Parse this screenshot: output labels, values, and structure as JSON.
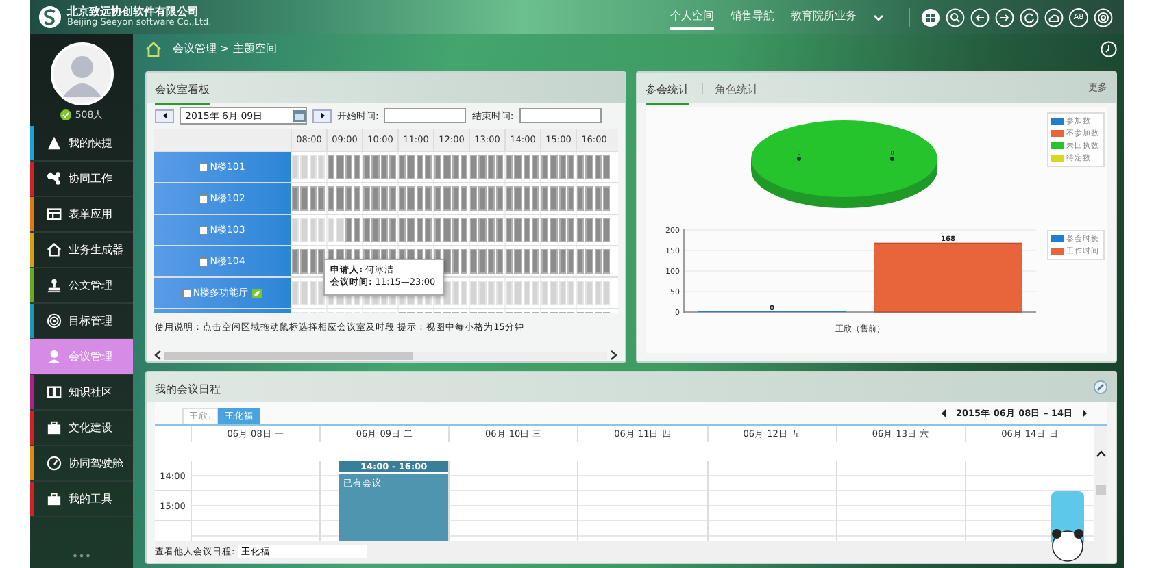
{
  "header": {
    "company": "北京致远协创软件有限公司",
    "company_en": "Beijing Seeyon software Co.,Ltd.",
    "nav": [
      {
        "label": "个人空间",
        "selected": true
      },
      {
        "label": "销售导航",
        "selected": false
      },
      {
        "label": "教育院所业务",
        "selected": false
      }
    ],
    "badge": "A8"
  },
  "sidebar": {
    "status": "508人",
    "items": [
      {
        "label": "我的快捷",
        "color": "#1aa3d6",
        "selected": false
      },
      {
        "label": "协同工作",
        "color": "#d42020",
        "selected": false
      },
      {
        "label": "表单应用",
        "color": "#e07a10",
        "selected": false
      },
      {
        "label": "业务生成器",
        "color": "#d4a010",
        "selected": false
      },
      {
        "label": "公文管理",
        "color": "#6aaa20",
        "selected": false
      },
      {
        "label": "目标管理",
        "color": "#1a9ab0",
        "selected": false
      },
      {
        "label": "会议管理",
        "color": "#d68be6",
        "selected": true
      },
      {
        "label": "知识社区",
        "color": "#b0208a",
        "selected": false
      },
      {
        "label": "文化建设",
        "color": "#d42020",
        "selected": false
      },
      {
        "label": "协同驾驶舱",
        "color": "#e08a10",
        "selected": false
      },
      {
        "label": "我的工具",
        "color": "#d42020",
        "selected": false
      }
    ],
    "more": "•••"
  },
  "breadcrumb": "会议管理 > 主题空间",
  "board": {
    "title": "会议室看板",
    "date": "2015年 6月 09日",
    "start_label": "开始时间:",
    "end_label": "结束时间:",
    "times": [
      "08:00",
      "09:00",
      "10:00",
      "11:00",
      "12:00",
      "13:00",
      "14:00",
      "15:00",
      "16:00"
    ],
    "rooms": [
      {
        "name": "N楼101",
        "checked": false,
        "has_icon": false,
        "booked": [
          false,
          false,
          false,
          false,
          true,
          true,
          true,
          true,
          true,
          true,
          true,
          true,
          true,
          true,
          true,
          true,
          true,
          true,
          true,
          true,
          true,
          true,
          true,
          true,
          true,
          true,
          true,
          true,
          true,
          true,
          true,
          true,
          true,
          true,
          true,
          true
        ]
      },
      {
        "name": "N楼102",
        "checked": false,
        "has_icon": false,
        "booked": [
          true,
          true,
          true,
          true,
          true,
          true,
          true,
          true,
          true,
          true,
          true,
          true,
          true,
          true,
          true,
          true,
          true,
          true,
          true,
          true,
          true,
          true,
          true,
          true,
          true,
          true,
          true,
          true,
          true,
          true,
          true,
          true,
          true,
          true,
          true,
          true
        ]
      },
      {
        "name": "N楼103",
        "checked": false,
        "has_icon": false,
        "booked": [
          false,
          false,
          false,
          false,
          false,
          false,
          true,
          true,
          true,
          true,
          true,
          true,
          true,
          true,
          true,
          true,
          true,
          true,
          true,
          true,
          true,
          true,
          true,
          true,
          true,
          true,
          true,
          true,
          true,
          true,
          true,
          true,
          true,
          true,
          true,
          true
        ]
      },
      {
        "name": "N楼104",
        "checked": false,
        "has_icon": false,
        "booked": [
          true,
          true,
          true,
          true,
          true,
          true,
          true,
          true,
          true,
          true,
          true,
          true,
          true,
          true,
          true,
          true,
          true,
          true,
          true,
          true,
          true,
          true,
          true,
          true,
          true,
          true,
          true,
          true,
          true,
          true,
          true,
          true,
          true,
          true,
          true,
          true
        ]
      },
      {
        "name": "N楼多功能厅",
        "checked": false,
        "has_icon": true,
        "booked": [
          false,
          false,
          false,
          false,
          false,
          false,
          false,
          false,
          false,
          false,
          false,
          false,
          false,
          false,
          false,
          false,
          false,
          false,
          false,
          false,
          false,
          false,
          false,
          false,
          false,
          false,
          false,
          false,
          false,
          false,
          false,
          false,
          false,
          false,
          false,
          false
        ]
      },
      {
        "booked": [
          false,
          false,
          false,
          false,
          false,
          false,
          false,
          false,
          false,
          false,
          false,
          false,
          true,
          true,
          true,
          true,
          true,
          true,
          true,
          true,
          true,
          true,
          true,
          true,
          true,
          true,
          true,
          true,
          true,
          true,
          true,
          true,
          true,
          true,
          true,
          true
        ]
      }
    ],
    "tooltip": {
      "applicant_label": "申请人:",
      "applicant": "何冰洁",
      "time_label": "会议时间:",
      "time": "11:15—23:00"
    },
    "note": "使用说明：点击空闲区域拖动鼠标选择相应会议室及时段 提示：视图中每小格为15分钟"
  },
  "stats": {
    "tabs": [
      {
        "label": "参会统计",
        "selected": true
      },
      {
        "label": "角色统计",
        "selected": false
      }
    ],
    "separator": "|",
    "more": "更多",
    "pie": {
      "labels": [
        "0",
        "0"
      ],
      "legend": [
        {
          "label": "参加数",
          "color": "#1e7fd0"
        },
        {
          "label": "不参加数",
          "color": "#e8643a"
        },
        {
          "label": "未回执数",
          "color": "#25c42d"
        },
        {
          "label": "待定数",
          "color": "#d8d81e"
        }
      ]
    },
    "chart_data": {
      "type": "bar",
      "categories": [
        "王欣（售前）"
      ],
      "series": [
        {
          "name": "参会时长",
          "color": "#1e7fd0",
          "values": [
            0
          ]
        },
        {
          "name": "工作时间",
          "color": "#e8643a",
          "values": [
            168
          ]
        }
      ],
      "ylim": [
        0,
        200
      ],
      "yticks": [
        0,
        50,
        100,
        150,
        200
      ],
      "grid": true,
      "data_labels": true
    }
  },
  "schedule": {
    "title": "我的会议日程",
    "tabs": [
      {
        "label": "王欣.",
        "selected": false
      },
      {
        "label": "王化福",
        "selected": true
      }
    ],
    "range": "2015年 06月 08日 – 14日",
    "days": [
      {
        "label": "06月 08日 一"
      },
      {
        "label": "06月 09日 二",
        "events": [
          {
            "time": "14:00 - 16:00",
            "title": "已有会议"
          }
        ]
      },
      {
        "label": "06月 10日 三"
      },
      {
        "label": "06月 11日 四"
      },
      {
        "label": "06月 12日 五"
      },
      {
        "label": "06月 13日 六"
      },
      {
        "label": "06月 14日 日"
      }
    ],
    "times": [
      "14:00",
      "15:00"
    ],
    "lookup_label": "查看他人会议日程:",
    "lookup_value": "王化福"
  }
}
